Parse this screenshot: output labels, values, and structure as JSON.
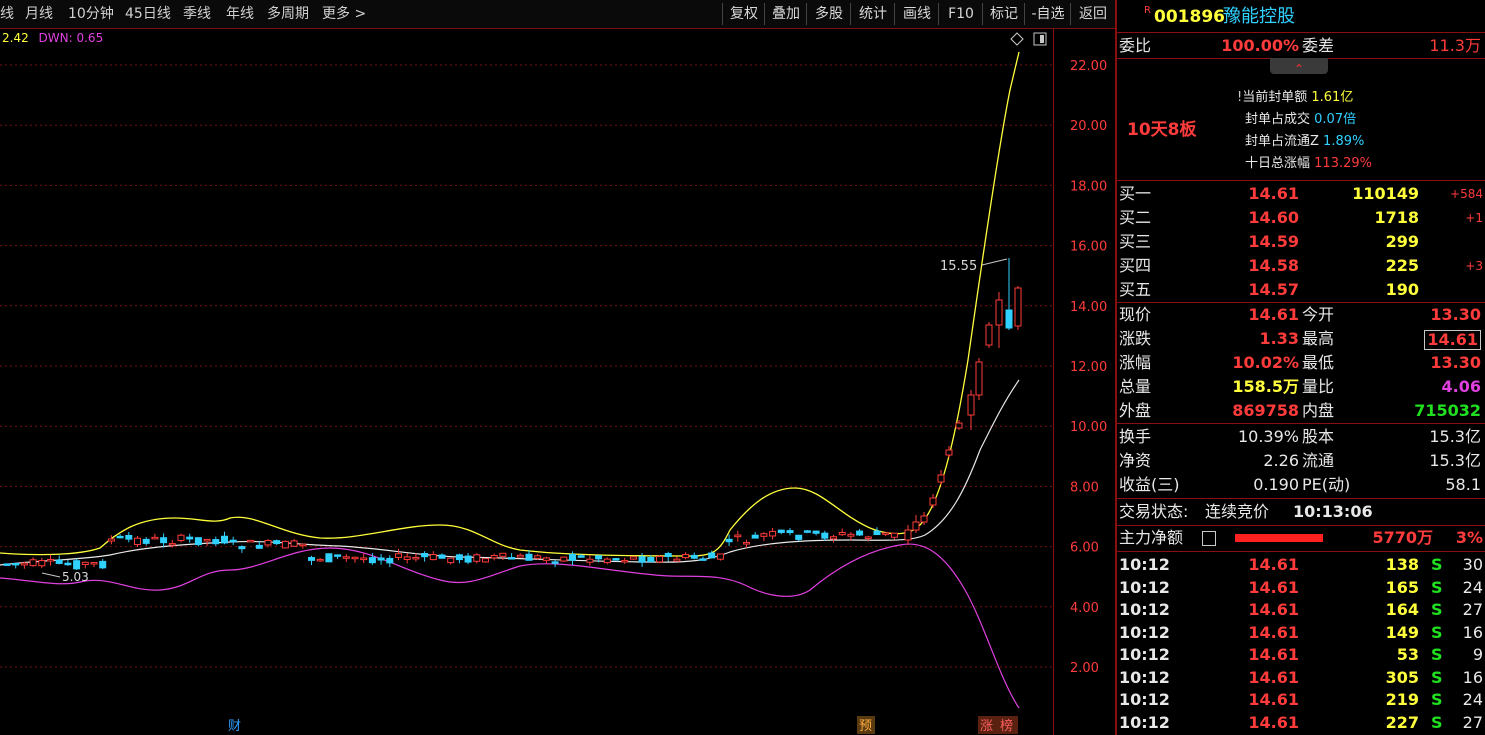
{
  "toolbar": {
    "left_items": [
      "线",
      "月线",
      "10分钟",
      "45日线",
      "季线",
      "年线",
      "多周期",
      "更多"
    ],
    "right_buttons": [
      "复权",
      "叠加",
      "多股",
      "统计",
      "画线",
      "F10",
      "标记",
      "-自选",
      "返回"
    ]
  },
  "indicator": {
    "up": "2.42",
    "dwn_label": "DWN: 0.65"
  },
  "price_axis": [
    "22.00",
    "20.00",
    "18.00",
    "16.00",
    "14.00",
    "12.00",
    "10.00",
    "8.00",
    "6.00",
    "4.00",
    "2.00"
  ],
  "annotations": {
    "high_mark": "15.55",
    "low_mark": "5.03"
  },
  "bottom_markers": {
    "fin": "财",
    "pre": "预",
    "zhang": "涨",
    "bang": "榜"
  },
  "colors": {
    "up": "#ff3b3b",
    "down": "#30d0ff",
    "ma_yellow": "#ffff3b",
    "ma_white": "#e8e8e8",
    "ma_magenta": "#e040e0",
    "grid": "#8a1010"
  },
  "stock": {
    "flag": "R",
    "code": "001896",
    "name": "豫能控股"
  },
  "weibi": {
    "label": "委比",
    "value": "100.00%",
    "diff_label": "委差",
    "diff_value": "11.3万"
  },
  "seal": {
    "tag": "10天8板",
    "lines": [
      {
        "label": "当前封单额",
        "value": "1.61亿"
      },
      {
        "label": "封单占成交",
        "value": "0.07倍"
      },
      {
        "label": "封单占流通Z",
        "value": "1.89%"
      },
      {
        "label": "十日总涨幅",
        "value": "113.29%"
      }
    ]
  },
  "bids": [
    {
      "label": "买一",
      "price": "14.61",
      "vol": "110149",
      "chg": "+584"
    },
    {
      "label": "买二",
      "price": "14.60",
      "vol": "1718",
      "chg": "+1"
    },
    {
      "label": "买三",
      "price": "14.59",
      "vol": "299",
      "chg": ""
    },
    {
      "label": "买四",
      "price": "14.58",
      "vol": "225",
      "chg": "+3"
    },
    {
      "label": "买五",
      "price": "14.57",
      "vol": "190",
      "chg": ""
    }
  ],
  "quote": [
    {
      "l1": "现价",
      "v1": "14.61",
      "l2": "今开",
      "v2": "13.30"
    },
    {
      "l1": "涨跌",
      "v1": "1.33",
      "l2": "最高",
      "v2": "14.61"
    },
    {
      "l1": "涨幅",
      "v1": "10.02%",
      "l2": "最低",
      "v2": "13.30"
    },
    {
      "l1": "总量",
      "v1": "158.5万",
      "l2": "量比",
      "v2": "4.06"
    },
    {
      "l1": "外盘",
      "v1": "869758",
      "l2": "内盘",
      "v2": "715032"
    }
  ],
  "fund": [
    {
      "l1": "换手",
      "v1": "10.39%",
      "l2": "股本",
      "v2": "15.3亿"
    },
    {
      "l1": "净资",
      "v1": "2.26",
      "l2": "流通",
      "v2": "15.3亿"
    },
    {
      "l1": "收益(三)",
      "v1": "0.190",
      "l2": "PE(动)",
      "v2": "58.1"
    }
  ],
  "status": {
    "label": "交易状态:",
    "value": "连续竞价",
    "time": "10:13:06"
  },
  "main_force": {
    "label": "主力净额",
    "value": "5770万",
    "pct": "3%"
  },
  "ticks": [
    {
      "time": "10:12",
      "price": "14.61",
      "vol": "138",
      "side": "S",
      "n": "30"
    },
    {
      "time": "10:12",
      "price": "14.61",
      "vol": "165",
      "side": "S",
      "n": "24"
    },
    {
      "time": "10:12",
      "price": "14.61",
      "vol": "164",
      "side": "S",
      "n": "27"
    },
    {
      "time": "10:12",
      "price": "14.61",
      "vol": "149",
      "side": "S",
      "n": "16"
    },
    {
      "time": "10:12",
      "price": "14.61",
      "vol": "53",
      "side": "S",
      "n": "9"
    },
    {
      "time": "10:12",
      "price": "14.61",
      "vol": "305",
      "side": "S",
      "n": "16"
    },
    {
      "time": "10:12",
      "price": "14.61",
      "vol": "219",
      "side": "S",
      "n": "24"
    },
    {
      "time": "10:12",
      "price": "14.61",
      "vol": "227",
      "side": "S",
      "n": "27"
    }
  ]
}
